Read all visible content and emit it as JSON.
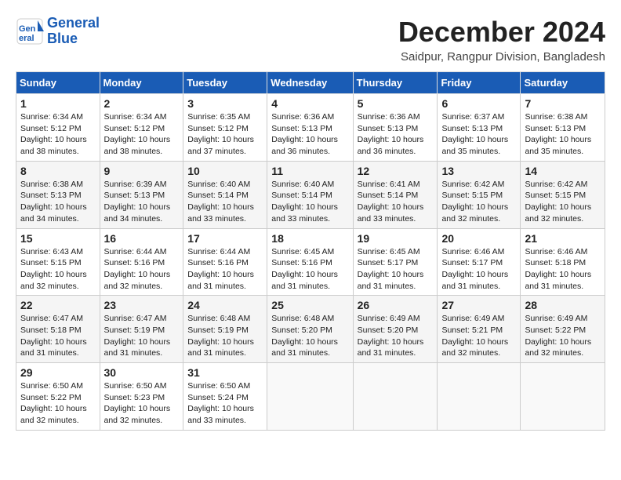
{
  "header": {
    "logo_line1": "General",
    "logo_line2": "Blue",
    "month_title": "December 2024",
    "location": "Saidpur, Rangpur Division, Bangladesh"
  },
  "weekdays": [
    "Sunday",
    "Monday",
    "Tuesday",
    "Wednesday",
    "Thursday",
    "Friday",
    "Saturday"
  ],
  "weeks": [
    [
      {
        "day": "1",
        "info": "Sunrise: 6:34 AM\nSunset: 5:12 PM\nDaylight: 10 hours\nand 38 minutes."
      },
      {
        "day": "2",
        "info": "Sunrise: 6:34 AM\nSunset: 5:12 PM\nDaylight: 10 hours\nand 38 minutes."
      },
      {
        "day": "3",
        "info": "Sunrise: 6:35 AM\nSunset: 5:12 PM\nDaylight: 10 hours\nand 37 minutes."
      },
      {
        "day": "4",
        "info": "Sunrise: 6:36 AM\nSunset: 5:13 PM\nDaylight: 10 hours\nand 36 minutes."
      },
      {
        "day": "5",
        "info": "Sunrise: 6:36 AM\nSunset: 5:13 PM\nDaylight: 10 hours\nand 36 minutes."
      },
      {
        "day": "6",
        "info": "Sunrise: 6:37 AM\nSunset: 5:13 PM\nDaylight: 10 hours\nand 35 minutes."
      },
      {
        "day": "7",
        "info": "Sunrise: 6:38 AM\nSunset: 5:13 PM\nDaylight: 10 hours\nand 35 minutes."
      }
    ],
    [
      {
        "day": "8",
        "info": "Sunrise: 6:38 AM\nSunset: 5:13 PM\nDaylight: 10 hours\nand 34 minutes."
      },
      {
        "day": "9",
        "info": "Sunrise: 6:39 AM\nSunset: 5:13 PM\nDaylight: 10 hours\nand 34 minutes."
      },
      {
        "day": "10",
        "info": "Sunrise: 6:40 AM\nSunset: 5:14 PM\nDaylight: 10 hours\nand 33 minutes."
      },
      {
        "day": "11",
        "info": "Sunrise: 6:40 AM\nSunset: 5:14 PM\nDaylight: 10 hours\nand 33 minutes."
      },
      {
        "day": "12",
        "info": "Sunrise: 6:41 AM\nSunset: 5:14 PM\nDaylight: 10 hours\nand 33 minutes."
      },
      {
        "day": "13",
        "info": "Sunrise: 6:42 AM\nSunset: 5:15 PM\nDaylight: 10 hours\nand 32 minutes."
      },
      {
        "day": "14",
        "info": "Sunrise: 6:42 AM\nSunset: 5:15 PM\nDaylight: 10 hours\nand 32 minutes."
      }
    ],
    [
      {
        "day": "15",
        "info": "Sunrise: 6:43 AM\nSunset: 5:15 PM\nDaylight: 10 hours\nand 32 minutes."
      },
      {
        "day": "16",
        "info": "Sunrise: 6:44 AM\nSunset: 5:16 PM\nDaylight: 10 hours\nand 32 minutes."
      },
      {
        "day": "17",
        "info": "Sunrise: 6:44 AM\nSunset: 5:16 PM\nDaylight: 10 hours\nand 31 minutes."
      },
      {
        "day": "18",
        "info": "Sunrise: 6:45 AM\nSunset: 5:16 PM\nDaylight: 10 hours\nand 31 minutes."
      },
      {
        "day": "19",
        "info": "Sunrise: 6:45 AM\nSunset: 5:17 PM\nDaylight: 10 hours\nand 31 minutes."
      },
      {
        "day": "20",
        "info": "Sunrise: 6:46 AM\nSunset: 5:17 PM\nDaylight: 10 hours\nand 31 minutes."
      },
      {
        "day": "21",
        "info": "Sunrise: 6:46 AM\nSunset: 5:18 PM\nDaylight: 10 hours\nand 31 minutes."
      }
    ],
    [
      {
        "day": "22",
        "info": "Sunrise: 6:47 AM\nSunset: 5:18 PM\nDaylight: 10 hours\nand 31 minutes."
      },
      {
        "day": "23",
        "info": "Sunrise: 6:47 AM\nSunset: 5:19 PM\nDaylight: 10 hours\nand 31 minutes."
      },
      {
        "day": "24",
        "info": "Sunrise: 6:48 AM\nSunset: 5:19 PM\nDaylight: 10 hours\nand 31 minutes."
      },
      {
        "day": "25",
        "info": "Sunrise: 6:48 AM\nSunset: 5:20 PM\nDaylight: 10 hours\nand 31 minutes."
      },
      {
        "day": "26",
        "info": "Sunrise: 6:49 AM\nSunset: 5:20 PM\nDaylight: 10 hours\nand 31 minutes."
      },
      {
        "day": "27",
        "info": "Sunrise: 6:49 AM\nSunset: 5:21 PM\nDaylight: 10 hours\nand 32 minutes."
      },
      {
        "day": "28",
        "info": "Sunrise: 6:49 AM\nSunset: 5:22 PM\nDaylight: 10 hours\nand 32 minutes."
      }
    ],
    [
      {
        "day": "29",
        "info": "Sunrise: 6:50 AM\nSunset: 5:22 PM\nDaylight: 10 hours\nand 32 minutes."
      },
      {
        "day": "30",
        "info": "Sunrise: 6:50 AM\nSunset: 5:23 PM\nDaylight: 10 hours\nand 32 minutes."
      },
      {
        "day": "31",
        "info": "Sunrise: 6:50 AM\nSunset: 5:24 PM\nDaylight: 10 hours\nand 33 minutes."
      },
      {
        "day": "",
        "info": ""
      },
      {
        "day": "",
        "info": ""
      },
      {
        "day": "",
        "info": ""
      },
      {
        "day": "",
        "info": ""
      }
    ]
  ]
}
